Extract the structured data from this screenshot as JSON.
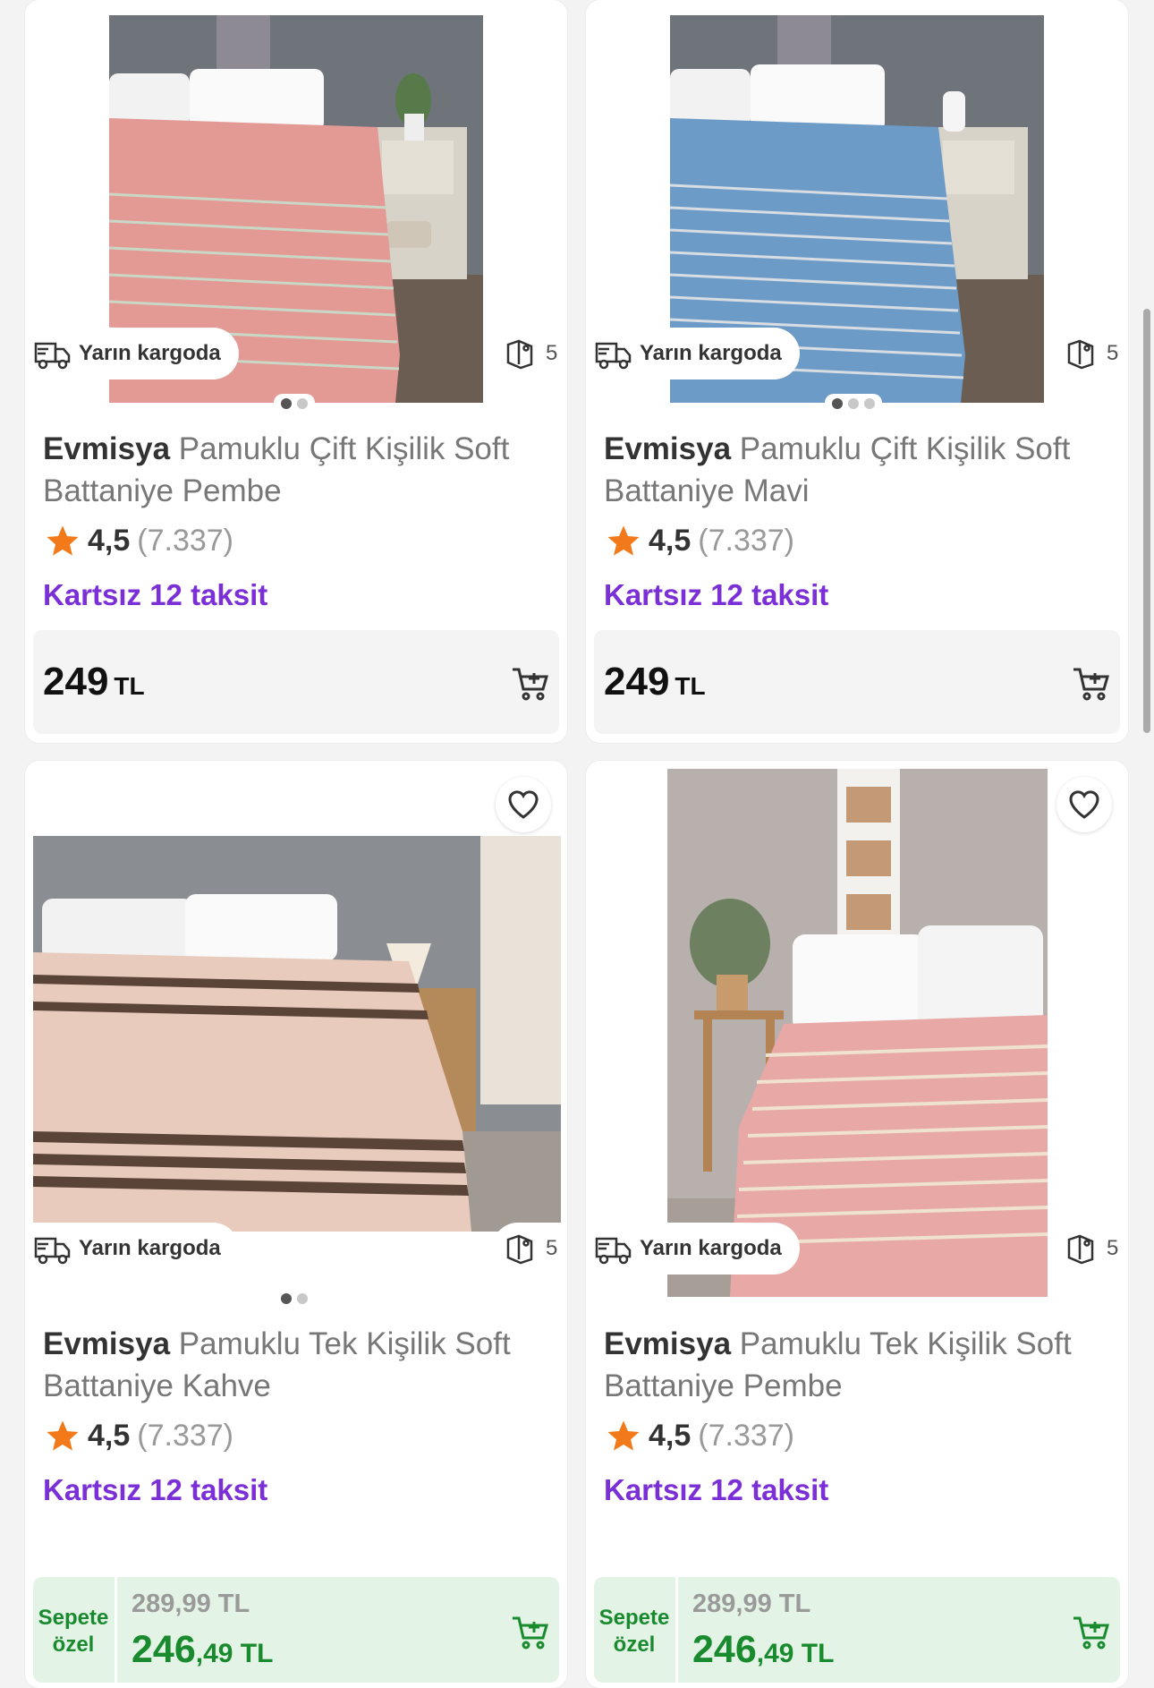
{
  "products": [
    {
      "brand": "Evmisya",
      "title_rest": "Pamuklu Çift Kişilik Soft",
      "title_line2": "Battaniye Pembe",
      "rating": "4,5",
      "review_count": "(7.337)",
      "installment": "Kartsız 12 taksit",
      "cargo": "Yarın kargoda",
      "coupon_count": "5",
      "price_int": "249",
      "price_currency": "TL",
      "photo_colors": {
        "wall": "#6f737a",
        "blanket": "#e39a95",
        "stripe": "#c9d7c6",
        "floor": "#6b5d52"
      }
    },
    {
      "brand": "Evmisya",
      "title_rest": "Pamuklu Çift Kişilik Soft",
      "title_line2": "Battaniye Mavi",
      "rating": "4,5",
      "review_count": "(7.337)",
      "installment": "Kartsız 12 taksit",
      "cargo": "Yarın kargoda",
      "coupon_count": "5",
      "price_int": "249",
      "price_currency": "TL",
      "photo_colors": {
        "wall": "#6f737a",
        "blanket": "#6d9bc7",
        "stripe": "#d7dde2",
        "floor": "#6b5d52"
      }
    },
    {
      "brand": "Evmisya",
      "title_rest": "Pamuklu Tek Kişilik Soft",
      "title_line2": "Battaniye Kahve",
      "rating": "4,5",
      "review_count": "(7.337)",
      "installment": "Kartsız 12 taksit",
      "cargo": "Yarın kargoda",
      "coupon_count": "5",
      "promo_label_1": "Sepete",
      "promo_label_2": "özel",
      "old_price": "289,99 TL",
      "new_price_int": "246",
      "new_price_dec": ",49 TL",
      "photo_colors": {
        "wall": "#8a8d92",
        "blanket": "#e8cbbd",
        "stripe": "#5a4438",
        "floor": "#a19a93"
      }
    },
    {
      "brand": "Evmisya",
      "title_rest": "Pamuklu Tek Kişilik Soft",
      "title_line2": "Battaniye Pembe",
      "rating": "4,5",
      "review_count": "(7.337)",
      "installment": "Kartsız 12 taksit",
      "cargo": "Yarın kargoda",
      "coupon_count": "5",
      "promo_label_1": "Sepete",
      "promo_label_2": "özel",
      "old_price": "289,99 TL",
      "new_price_int": "246",
      "new_price_dec": ",49 TL",
      "photo_colors": {
        "wall": "#b7b0ad",
        "blanket": "#e7a8a6",
        "stripe": "#efe2cf",
        "floor": "#a79e97"
      }
    }
  ],
  "colors": {
    "installment": "#7b2fd6",
    "promo_green": "#1a8a2e",
    "star": "#f27a1a"
  }
}
